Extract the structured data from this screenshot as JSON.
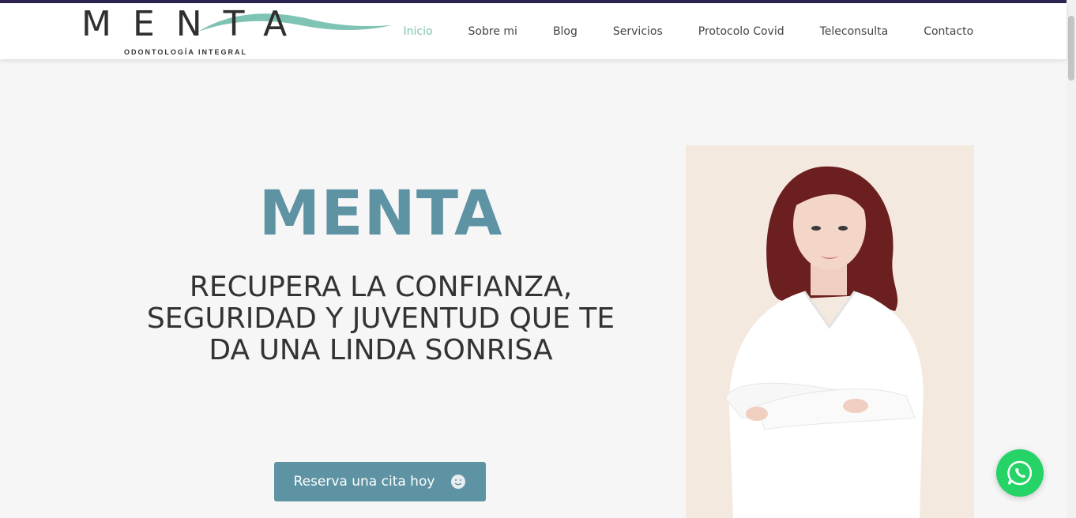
{
  "brand": {
    "name": "MENTA",
    "tagline": "ODONTOLOGÍA INTEGRAL"
  },
  "nav": {
    "items": [
      {
        "label": "Inicio",
        "active": true
      },
      {
        "label": "Sobre mi"
      },
      {
        "label": "Blog"
      },
      {
        "label": "Servicios"
      },
      {
        "label": "Protocolo Covid"
      },
      {
        "label": "Teleconsulta"
      },
      {
        "label": "Contacto"
      }
    ]
  },
  "hero": {
    "title": "MENTA",
    "subtitle_lines": [
      "RECUPERA LA CONFIANZA,",
      "SEGURIDAD Y JUVENTUD QUE TE",
      "DA UNA LINDA SONRISA"
    ],
    "cta_label": "Reserva una cita hoy",
    "cta_icon": "smiley-icon"
  },
  "floating": {
    "icon": "whatsapp-icon"
  },
  "colors": {
    "accent": "#5d93a3",
    "nav_active": "#7ec3b3",
    "top_bar": "#2f2450",
    "whatsapp": "#25d366"
  }
}
